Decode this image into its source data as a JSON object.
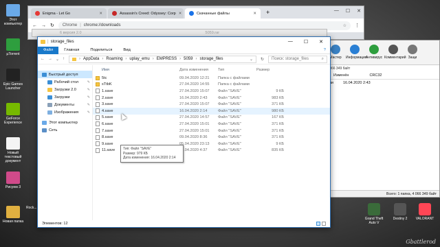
{
  "desktop": {
    "icons": [
      {
        "label": "Этот компьютер",
        "color": "#6aa9e8"
      },
      {
        "label": "µTorrent",
        "color": "#2e9e3e"
      },
      {
        "label": "Epic Games Launcher",
        "color": "#222222"
      },
      {
        "label": "GeForce Experience",
        "color": "#76b900"
      },
      {
        "label": "Новый текстовый документ",
        "color": "#f4f4f4"
      },
      {
        "label": "Рисуем 3",
        "color": "#d04a8a"
      },
      {
        "label": "Новая папка",
        "color": "#e0b040"
      }
    ],
    "dock": [
      {
        "label": "Grand Theft Auto V",
        "color": "#3a6b3a"
      },
      {
        "label": "Destiny 2",
        "color": "#555555"
      },
      {
        "label": "VALORANT",
        "color": "#ff4655"
      }
    ],
    "partial_left_label": "Rock...",
    "watermark": "Gbattlerod"
  },
  "chrome": {
    "tabs": [
      {
        "label": "Enigma - Let Go",
        "color": "#e53935",
        "active": false
      },
      {
        "label": "Assassin's Creed: Odyssey: Corp",
        "color": "#c62828",
        "active": false
      },
      {
        "label": "Скачанные файлы",
        "color": "#1a73e8",
        "active": true
      }
    ],
    "new_tab": "+",
    "omnibox_scheme": "Chrome",
    "omnibox_url": "chrome://downloads",
    "partial_title": "6 версия 2.0",
    "partial_title2": "5059.rar"
  },
  "archive": {
    "tools": [
      {
        "label": "Мастер",
        "color": "#3b82c4"
      },
      {
        "label": "Информация",
        "color": "#2a7fd4"
      },
      {
        "label": "Антивирус",
        "color": "#2e9e3e"
      },
      {
        "label": "Комментарий",
        "color": "#555555"
      },
      {
        "label": "Защи",
        "color": "#777777"
      }
    ],
    "info": "4 066 349 байт",
    "columns": [
      "Изменён",
      "CRC32"
    ],
    "row_type": "ими",
    "row_date": "16.04.2020 2:43",
    "status": "Всего: 1 папка, 4 066 349 байт"
  },
  "explorer": {
    "title": "storage_files",
    "window_controls": [
      "—",
      "☐",
      "✕"
    ],
    "ribbon": [
      "Файл",
      "Главная",
      "Поделиться",
      "Вид"
    ],
    "help": "?",
    "path": [
      "AppData",
      "Roaming",
      "uplay_emu",
      "EMPRESS",
      "5059",
      "storage_files"
    ],
    "search_placeholder": "Поиск: storage_files",
    "nav": [
      {
        "label": "Быстрый доступ",
        "color": "#3c8fd6",
        "sub": false,
        "pin": false,
        "sel": true
      },
      {
        "label": "Рабочий стол",
        "color": "#3c8fd6",
        "sub": true,
        "pin": true,
        "sel": false
      },
      {
        "label": "Загрузки 2.0",
        "color": "#f5c542",
        "sub": true,
        "pin": true,
        "sel": false
      },
      {
        "label": "Загрузки",
        "color": "#3c8fd6",
        "sub": true,
        "pin": true,
        "sel": false
      },
      {
        "label": "Документы",
        "color": "#8aa0b8",
        "sub": true,
        "pin": true,
        "sel": false
      },
      {
        "label": "Изображения",
        "color": "#7fb0e0",
        "sub": true,
        "pin": true,
        "sel": false
      },
      {
        "label": "Этот компьютер",
        "color": "#6aa9e8",
        "sub": false,
        "pin": false,
        "sel": false
      },
      {
        "label": "Сеть",
        "color": "#5b8fc7",
        "sub": false,
        "pin": false,
        "sel": false
      }
    ],
    "columns": {
      "name": "Имя",
      "date": "Дата изменения",
      "type": "Тип",
      "size": "Размер"
    },
    "files": [
      {
        "name": "5tc",
        "date": "09.04.2020 12:21",
        "type": "Папка с файлами",
        "size": "",
        "folder": true
      },
      {
        "name": "sTtbK",
        "date": "27.04.2020 14:55",
        "type": "Папка с файлами",
        "size": "",
        "folder": true
      },
      {
        "name": "1.save",
        "date": "27.04.2020 15:07",
        "type": "Файл \"SAVE\"",
        "size": "9 КБ",
        "folder": false
      },
      {
        "name": "2.save",
        "date": "16.04.2020 2:43",
        "type": "Файл \"SAVE\"",
        "size": "983 КБ",
        "folder": false
      },
      {
        "name": "3.save",
        "date": "27.04.2020 15:07",
        "type": "Файл \"SAVE\"",
        "size": "371 КБ",
        "folder": false
      },
      {
        "name": "4.save",
        "date": "16.04.2020 2:14",
        "type": "Файл \"SAVE\"",
        "size": "980 КБ",
        "folder": false
      },
      {
        "name": "5.save",
        "date": "27.04.2020 14:57",
        "type": "Файл \"SAVE\"",
        "size": "167 КБ",
        "folder": false
      },
      {
        "name": "6.save",
        "date": "27.04.2020 15:01",
        "type": "Файл \"SAVE\"",
        "size": "371 КБ",
        "folder": false
      },
      {
        "name": "7.save",
        "date": "27.04.2020 15:01",
        "type": "Файл \"SAVE\"",
        "size": "371 КБ",
        "folder": false
      },
      {
        "name": "8.save",
        "date": "09.04.2020 8:36",
        "type": "Файл \"SAVE\"",
        "size": "371 КБ",
        "folder": false
      },
      {
        "name": "9.save",
        "date": "05.04.2020 23:13",
        "type": "Файл \"SAVE\"",
        "size": "9 КБ",
        "folder": false
      },
      {
        "name": "11.save",
        "date": "09.04.2020 4:37",
        "type": "Файл \"SAVE\"",
        "size": "835 КБ",
        "folder": false
      }
    ],
    "hover_index": 5,
    "tooltip": [
      "Тип: Файл \"SAVE\"",
      "Размер: 979 КБ",
      "Дата изменения: 16.04.2020 2:14"
    ],
    "status": "Элементов: 12"
  }
}
